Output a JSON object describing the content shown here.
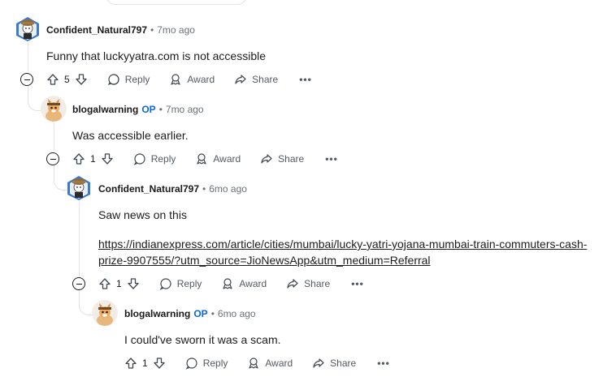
{
  "comments": [
    {
      "author": "Confident_Natural797",
      "op": "",
      "separator": "•",
      "time": "7mo ago",
      "body": "Funny that luckyyatra.com is not accessible",
      "votes": "5"
    },
    {
      "author": "blogalwarning",
      "op": "OP",
      "separator": "•",
      "time": "7mo ago",
      "body": "Was accessible earlier.",
      "votes": "1"
    },
    {
      "author": "Confident_Natural797",
      "op": "",
      "separator": "•",
      "time": "6mo ago",
      "body": "Saw news on this",
      "link_line1": "https://indianexpress.com/article/cities/mumbai/lucky-yatri-yojana-mumbai-train-commuters-cash-",
      "link_line2": "prize-9907555/?utm_source=JioNewsApp&utm_medium=Referral",
      "votes": "1"
    },
    {
      "author": "blogalwarning",
      "op": "OP",
      "separator": "•",
      "time": "6mo ago",
      "body": "I could've sworn it was a scam.",
      "votes": "1"
    }
  ],
  "actions": {
    "reply": "Reply",
    "award": "Award",
    "share": "Share",
    "more": "•••"
  },
  "colors": {
    "op_accent": "#0a68d8",
    "muted": "#6b7177",
    "thread_line": "#e2e4e6"
  },
  "icons": [
    "collapse-icon",
    "upvote-icon",
    "downvote-icon",
    "reply-icon",
    "award-icon",
    "share-icon",
    "more-icon"
  ]
}
